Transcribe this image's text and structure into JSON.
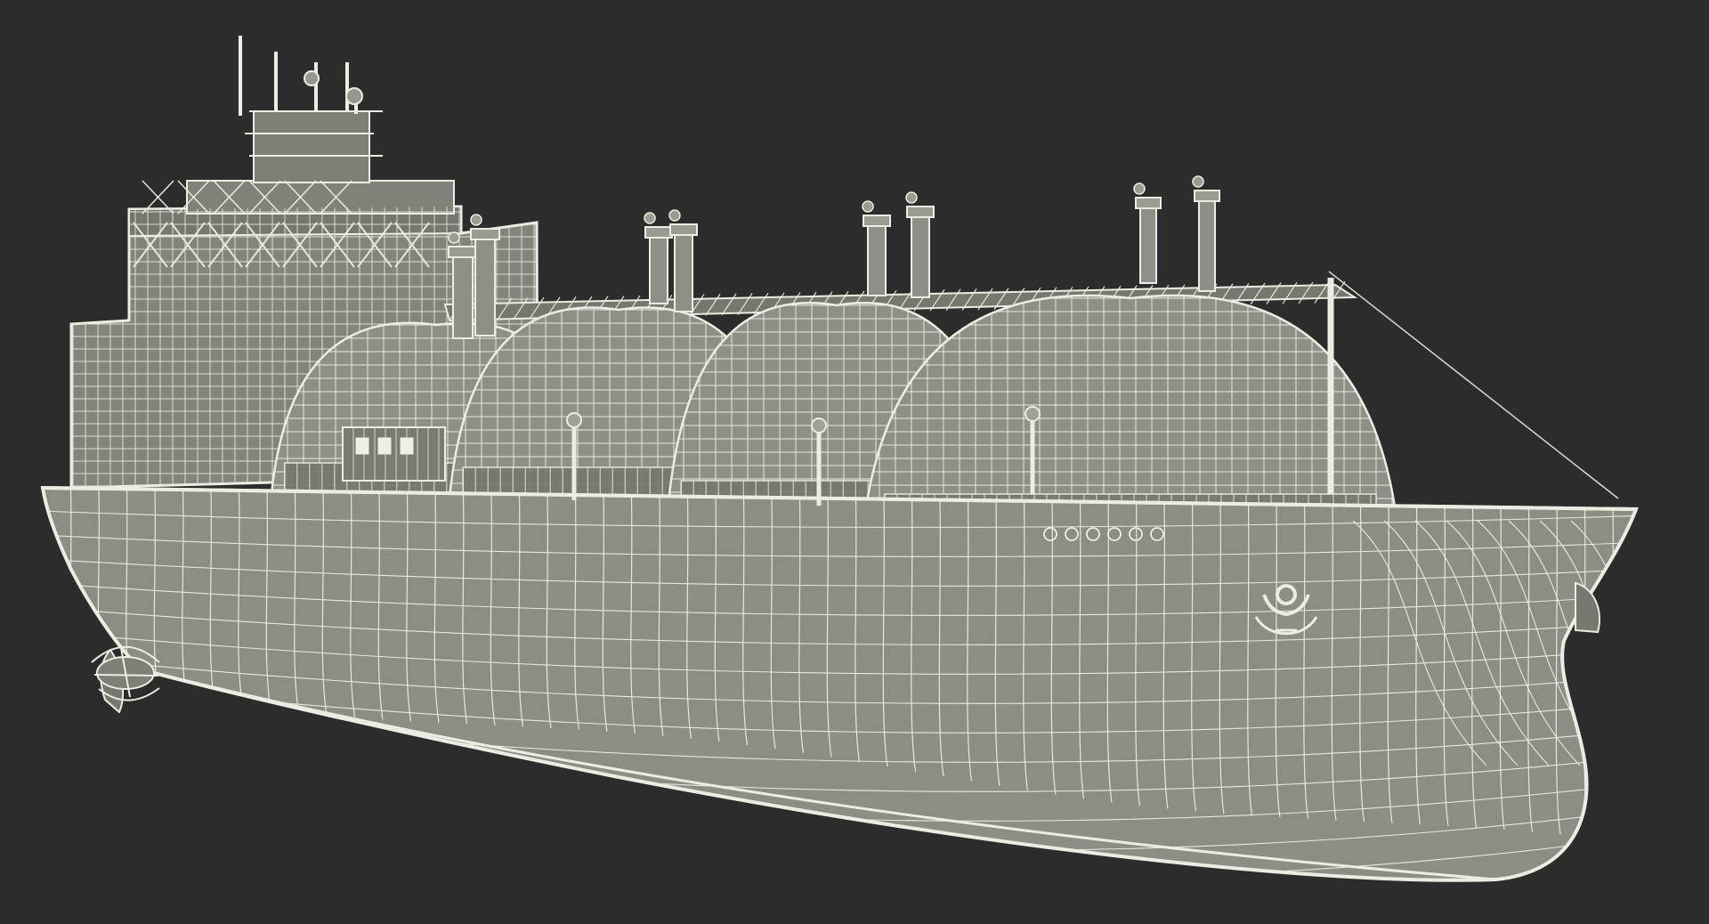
{
  "scene": {
    "subject": "lng-carrier-wireframe-render",
    "colors": {
      "background": "#2c2c2c",
      "hull_fill": "#8d8d84",
      "hull_shade": "#7a7a72",
      "tank_fill": "#8f8f87",
      "tank_shade": "#77776f",
      "superstructure_fill": "#84847c",
      "wire": "#ecece2",
      "wire_soft": "#d9d9cf"
    },
    "tank_count": 4,
    "icons": [
      "anchor-icon",
      "propeller-icon",
      "mast-icon",
      "bridge-icon"
    ]
  }
}
